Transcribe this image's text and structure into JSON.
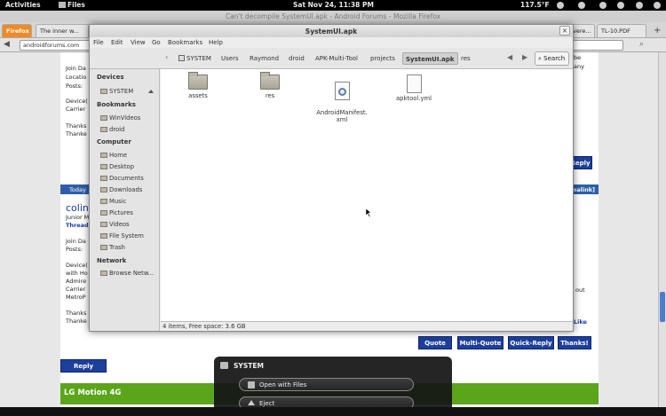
{
  "top_panel": {
    "activities": "Activities",
    "app_name": "Files",
    "clock": "Sat Nov 24, 11:38 PM",
    "temperature": "117.5°F"
  },
  "firefox": {
    "title": "Can't decompile SystemUI.apk - Android Forums - Mozilla Firefox",
    "menu_label": "Firefox",
    "tabs": [
      "The inner w...",
      "vere...",
      "TL-10.PDF"
    ],
    "url": "androidforums.com",
    "forum": {
      "post_head": "Today",
      "permalink": "malink]",
      "user_name": "colin",
      "user_title": "Junior M",
      "user_threads": "Thread",
      "join_date": "Join Da",
      "posts": "Posts:",
      "device": "Device(",
      "with": "with Ho",
      "admire": "Admire",
      "carrier": "Carrier",
      "metro": "MetroP",
      "thanks": "Thanks",
      "thanked": "Thanke",
      "top_join": "Join Da",
      "top_location": "Locatio",
      "top_posts": "Posts:",
      "top_device": "Device(",
      "top_carrier": "Carrier",
      "top_thanks": "Thanks",
      "top_thanked": "Thanke",
      "right_be": "be",
      "right_any": "any",
      "right_out": "out",
      "right_like": "Like",
      "reply_top": "Reply",
      "quote": "Quote",
      "multi_quote": "Multi-Quote",
      "quick_reply": "Quick-Reply",
      "thanks_btn": "Thanks!",
      "reply_bottom": "Reply",
      "section_title": "LG Motion 4G"
    }
  },
  "nautilus": {
    "title": "SystemUI.apk",
    "menu": [
      "File",
      "Edit",
      "View",
      "Go",
      "Bookmarks",
      "Help"
    ],
    "breadcrumbs": [
      "SYSTEM",
      "Users",
      "Raymond",
      "droid",
      "APK-Multi-Tool",
      "projects",
      "SystemUI.apk",
      "res"
    ],
    "search_label": "Search",
    "sidebar": {
      "devices_header": "Devices",
      "devices": [
        "SYSTEM"
      ],
      "bookmarks_header": "Bookmarks",
      "bookmarks": [
        "WinVideos",
        "droid"
      ],
      "computer_header": "Computer",
      "computer": [
        "Home",
        "Desktop",
        "Documents",
        "Downloads",
        "Music",
        "Pictures",
        "Videos",
        "File System",
        "Trash"
      ],
      "network_header": "Network",
      "network": [
        "Browse Netw..."
      ]
    },
    "files": [
      {
        "name": "assets",
        "kind": "folder"
      },
      {
        "name": "res",
        "kind": "folder"
      },
      {
        "name": "AndroidManifest.\nxml",
        "kind": "xml"
      },
      {
        "name": "apktool.yml",
        "kind": "doc"
      }
    ],
    "status": "4 items, Free space: 3.6 GB"
  },
  "notification": {
    "title": "SYSTEM",
    "open_with": "Open with Files",
    "eject": "Eject"
  }
}
